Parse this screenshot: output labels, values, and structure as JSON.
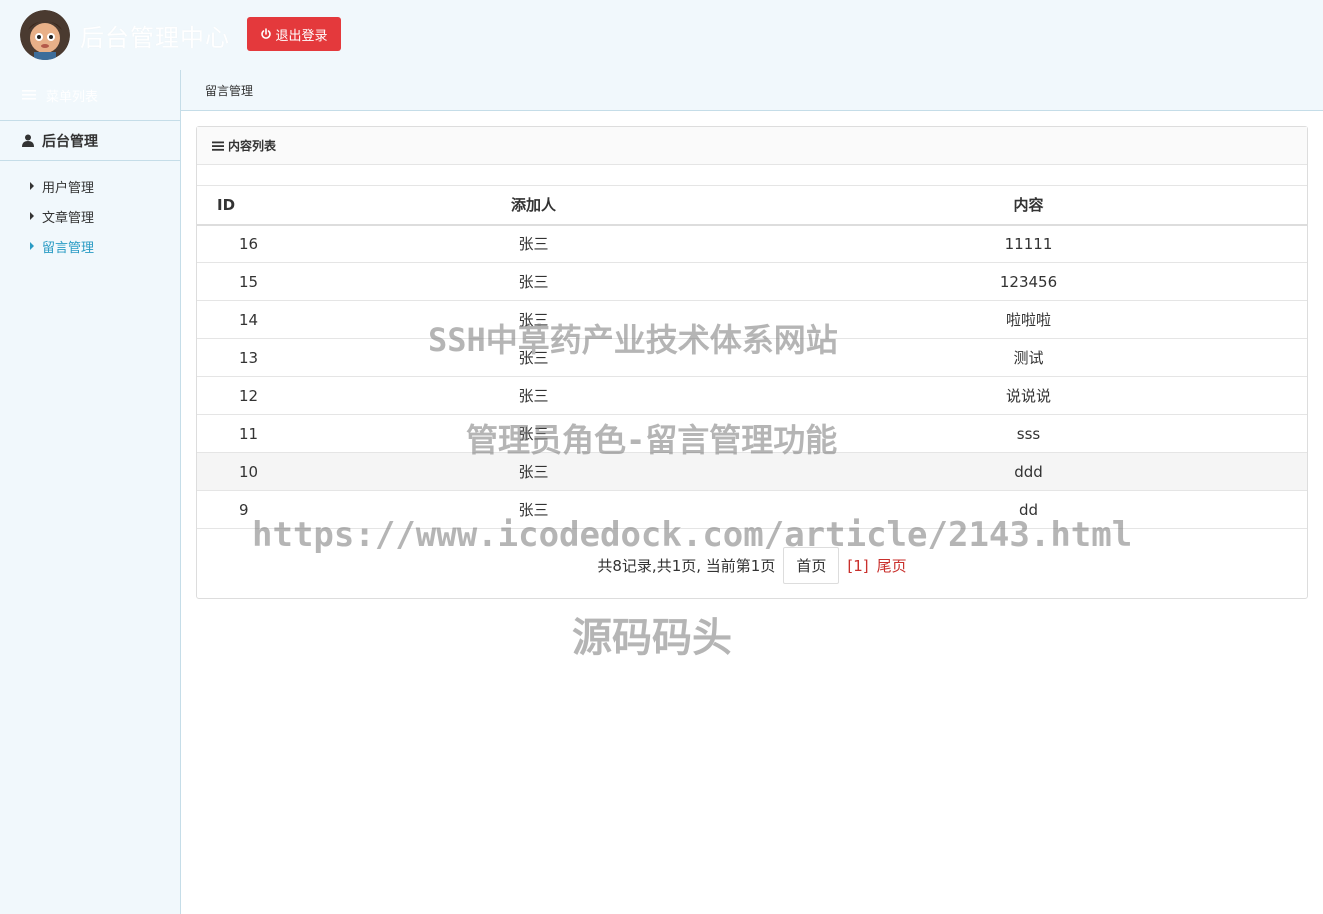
{
  "header": {
    "title": "后台管理中心",
    "logout_label": "退出登录"
  },
  "sidebar": {
    "menu_label": "菜单列表",
    "section_label": "后台管理",
    "items": [
      {
        "label": "用户管理"
      },
      {
        "label": "文章管理"
      },
      {
        "label": "留言管理"
      }
    ]
  },
  "breadcrumb": "留言管理",
  "panel": {
    "title": "内容列表"
  },
  "table": {
    "columns": [
      "ID",
      "添加人",
      "内容"
    ],
    "rows": [
      [
        "16",
        "张三",
        "11111"
      ],
      [
        "15",
        "张三",
        "123456"
      ],
      [
        "14",
        "张三",
        "啦啦啦"
      ],
      [
        "13",
        "张三",
        "测试"
      ],
      [
        "12",
        "张三",
        "说说说"
      ],
      [
        "11",
        "张三",
        "sss"
      ],
      [
        "10",
        "张三",
        "ddd"
      ],
      [
        "9",
        "张三",
        "dd"
      ]
    ]
  },
  "pagination": {
    "summary": "共8记录,共1页, 当前第1页",
    "first_label": "首页",
    "current_label": "[1]",
    "last_label": "尾页"
  },
  "watermarks": [
    "SSH中草药产业技术体系网站",
    "管理员角色-留言管理功能",
    "https://www.icodedock.com/article/2143.html",
    "源码码头"
  ],
  "colors": {
    "logout_button": "#e4393c",
    "active_nav": "#2a9bc4",
    "pager_link": "#c9302c",
    "header_bg": "#f1f8fc"
  }
}
